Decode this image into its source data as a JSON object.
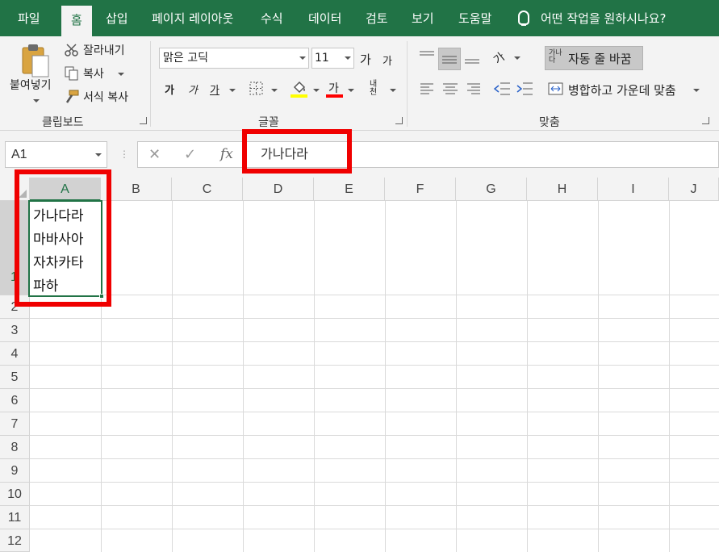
{
  "tabs": [
    "파일",
    "홈",
    "삽입",
    "페이지 레이아웃",
    "수식",
    "데이터",
    "검토",
    "보기",
    "도움말"
  ],
  "tell_me": "어떤 작업을 원하시나요?",
  "clipboard": {
    "paste": "붙여넣기",
    "cut": "잘라내기",
    "copy": "복사",
    "format_painter": "서식 복사",
    "group_label": "클립보드"
  },
  "font": {
    "name": "맑은 고딕",
    "size": "11",
    "grow": "가",
    "shrink": "가",
    "bold": "가",
    "italic": "가",
    "underline": "가",
    "font_color_glyph": "가",
    "phonetic": "내천",
    "group_label": "글꼴",
    "fill_color": "#ffff00",
    "text_color": "#ff0000"
  },
  "alignment": {
    "wrap_text_glyph": "가나다",
    "wrap_text": "자동 줄 바꿈",
    "merge_center": "병합하고 가운데 맞춤",
    "orientation_glyph": "가",
    "group_label": "맞춤"
  },
  "name_box": "A1",
  "formula_value": "가나다라",
  "fx_label": "fx",
  "columns": [
    "A",
    "B",
    "C",
    "D",
    "E",
    "F",
    "G",
    "H",
    "I",
    "J"
  ],
  "rows": [
    "1",
    "2",
    "3",
    "4",
    "5",
    "6",
    "7",
    "8",
    "9",
    "10",
    "11",
    "12"
  ],
  "cell_a1_lines": [
    "가나다라",
    "마바사아",
    "자차카타",
    "파하"
  ],
  "highlight_color": "#f00000",
  "accent_color": "#217346"
}
